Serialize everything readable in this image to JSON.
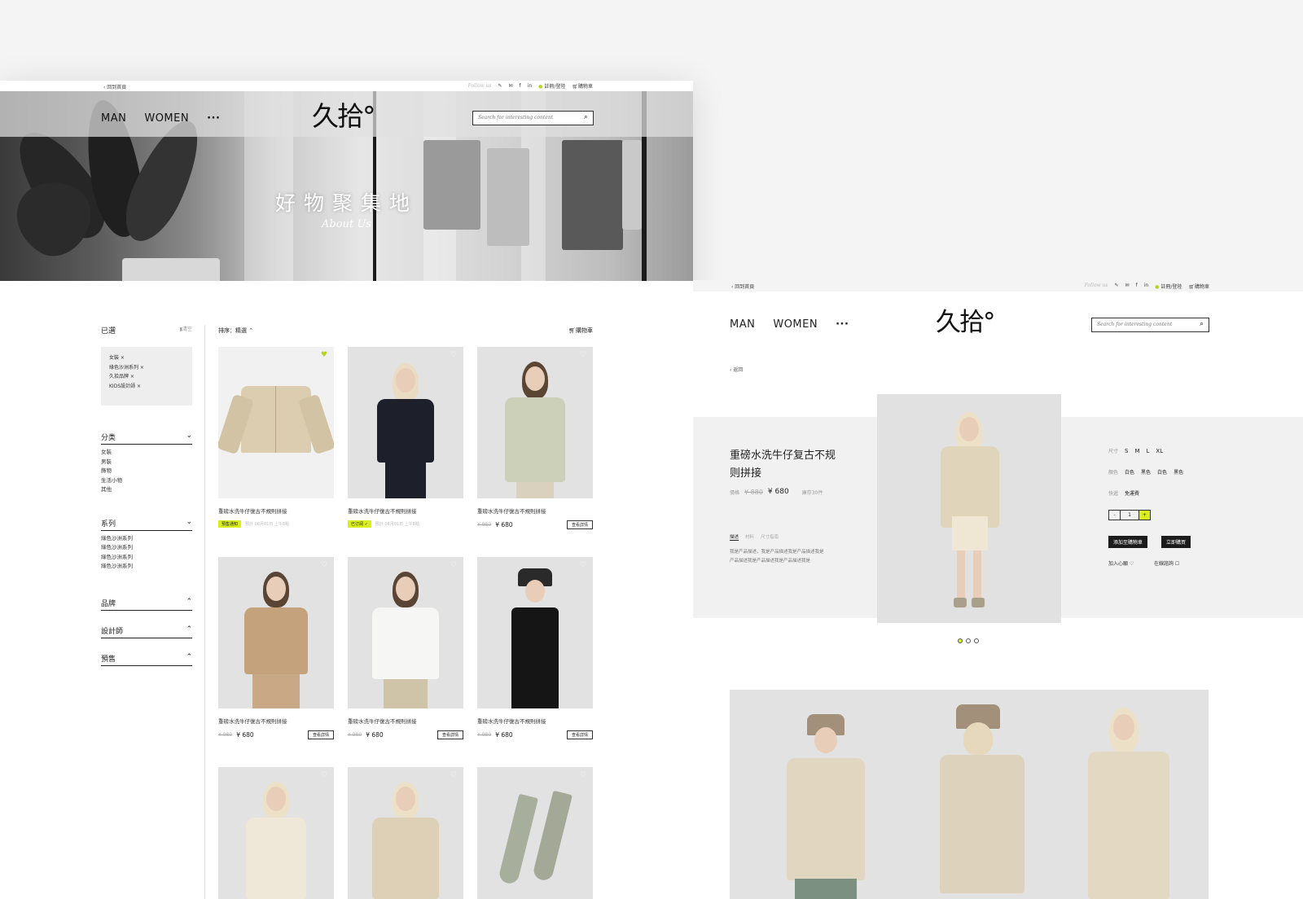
{
  "brand": {
    "logo": "久拾°",
    "accent": "#d8ef1d"
  },
  "left": {
    "topbar": {
      "back": "‹ 回到首頁",
      "follow": "Follow us",
      "social": [
        "✎",
        "✉",
        "f",
        "in"
      ],
      "login": "註冊/登陸",
      "cart": "購物車"
    },
    "nav": {
      "man": "MAN",
      "women": "WOMEN",
      "more": "···",
      "search_placeholder": "Search for interesting content"
    },
    "hero": {
      "title": "好物聚集地",
      "subtitle": "About Us"
    },
    "sidebar": {
      "selected_title": "已選",
      "clear": "清空",
      "selected": [
        "女裝 ×",
        "綠色沙洲系列 ×",
        "久拾品牌 ×",
        "KIDS設計師 ×"
      ],
      "category_title": "分类",
      "categories": [
        "女裝",
        "男裝",
        "飾物",
        "生活小物",
        "其他"
      ],
      "series_title": "系列",
      "series": [
        "綠色沙洲系列",
        "綠色沙洲系列",
        "綠色沙洲系列",
        "綠色沙洲系列"
      ],
      "brand_title": "品牌",
      "designer_title": "設計師",
      "presale_title": "預售"
    },
    "sort": {
      "label": "排序：精選 ⌃",
      "cart": "購物車"
    },
    "products": [
      {
        "name": "重磅水洗牛仔復古不規則拼接",
        "tag": "預售通知",
        "note": "預計 08月01日 上午8點"
      },
      {
        "name": "重磅水洗牛仔復古不規則拼接",
        "tag": "已订阅 ✓",
        "note": "預計 08月01日 上午8點"
      },
      {
        "name": "重磅水洗牛仔復古不規則拼接",
        "old": "¥ 980",
        "price": "¥ 680",
        "btn": "查看詳情"
      },
      {
        "name": "重磅水洗牛仔復古不規則拼接",
        "old": "¥ 980",
        "price": "¥ 680",
        "btn": "查看詳情"
      },
      {
        "name": "重磅水洗牛仔復古不規則拼接",
        "old": "¥ 980",
        "price": "¥ 680",
        "btn": "查看詳情"
      },
      {
        "name": "重磅水洗牛仔復古不規則拼接",
        "old": "¥ 980",
        "price": "¥ 680",
        "btn": "查看詳情"
      }
    ]
  },
  "right": {
    "topbar": {
      "back": "‹ 回到首頁",
      "follow": "Follow us",
      "social": [
        "✎",
        "✉",
        "f",
        "in"
      ],
      "login": "註冊/登陸",
      "cart": "購物車"
    },
    "nav": {
      "man": "MAN",
      "women": "WOMEN",
      "more": "···",
      "search_placeholder": "Search for interesting content"
    },
    "back": "‹ 返回",
    "product": {
      "title": "重磅水洗牛仔复古不规则拼接",
      "price_label": "價格",
      "old_price": "¥ 880",
      "price": "¥ 680",
      "stock": "庫存30件",
      "tabs": [
        "描述",
        "材料",
        "尺寸指南"
      ],
      "desc": "我是产品描述，我是产品描述我是产品描述我是产品描述我是产品描述我是产品描述我是",
      "size_label": "尺寸",
      "sizes": [
        "S",
        "M",
        "L",
        "XL"
      ],
      "color_label": "顏色",
      "colors": [
        "白色",
        "黑色",
        "白色",
        "黑色"
      ],
      "ship_label": "快遞",
      "ship": "免運費",
      "qty": "1",
      "minus": "-",
      "plus": "+",
      "add_cart": "添加至購物車",
      "buy": "立即購買",
      "wish": "加入心願 ♡",
      "consult": "在線諮詢 ☐"
    }
  }
}
